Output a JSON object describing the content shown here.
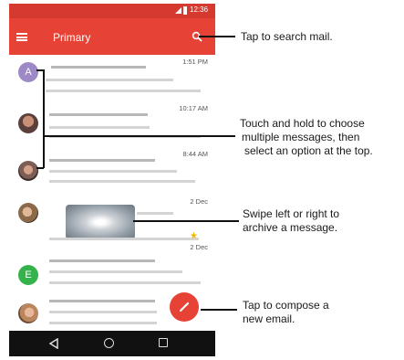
{
  "status_bar": {
    "time": "12:36"
  },
  "app_bar": {
    "title": "Primary"
  },
  "messages": [
    {
      "avatar_letter": "A",
      "timestamp": "1:51 PM"
    },
    {
      "avatar_letter": "",
      "timestamp": "10:17 AM"
    },
    {
      "avatar_letter": "",
      "timestamp": "8:44 AM"
    },
    {
      "avatar_letter": "",
      "timestamp": "2 Dec"
    },
    {
      "avatar_letter": "",
      "timestamp": "2 Dec"
    },
    {
      "avatar_letter": "E",
      "timestamp": ""
    },
    {
      "avatar_letter": "",
      "timestamp": ""
    }
  ],
  "callouts": {
    "search": "Tap to search mail.",
    "select_line1": "Touch and hold to choose",
    "select_line2": "multiple messages, then",
    "select_line3": "select an option at the top.",
    "archive_line1": "Swipe left or right to",
    "archive_line2": "archive a message.",
    "compose_line1": "Tap to compose a",
    "compose_line2": "new email."
  },
  "colors": {
    "app_bar": "#e74236",
    "status_bar": "#d6392d",
    "fab": "#e74236",
    "nav_bar": "#111111",
    "star": "#f2b600"
  },
  "icons": [
    "menu-icon",
    "search-icon",
    "pencil-icon",
    "back-icon",
    "home-icon",
    "recents-icon",
    "star-icon"
  ]
}
